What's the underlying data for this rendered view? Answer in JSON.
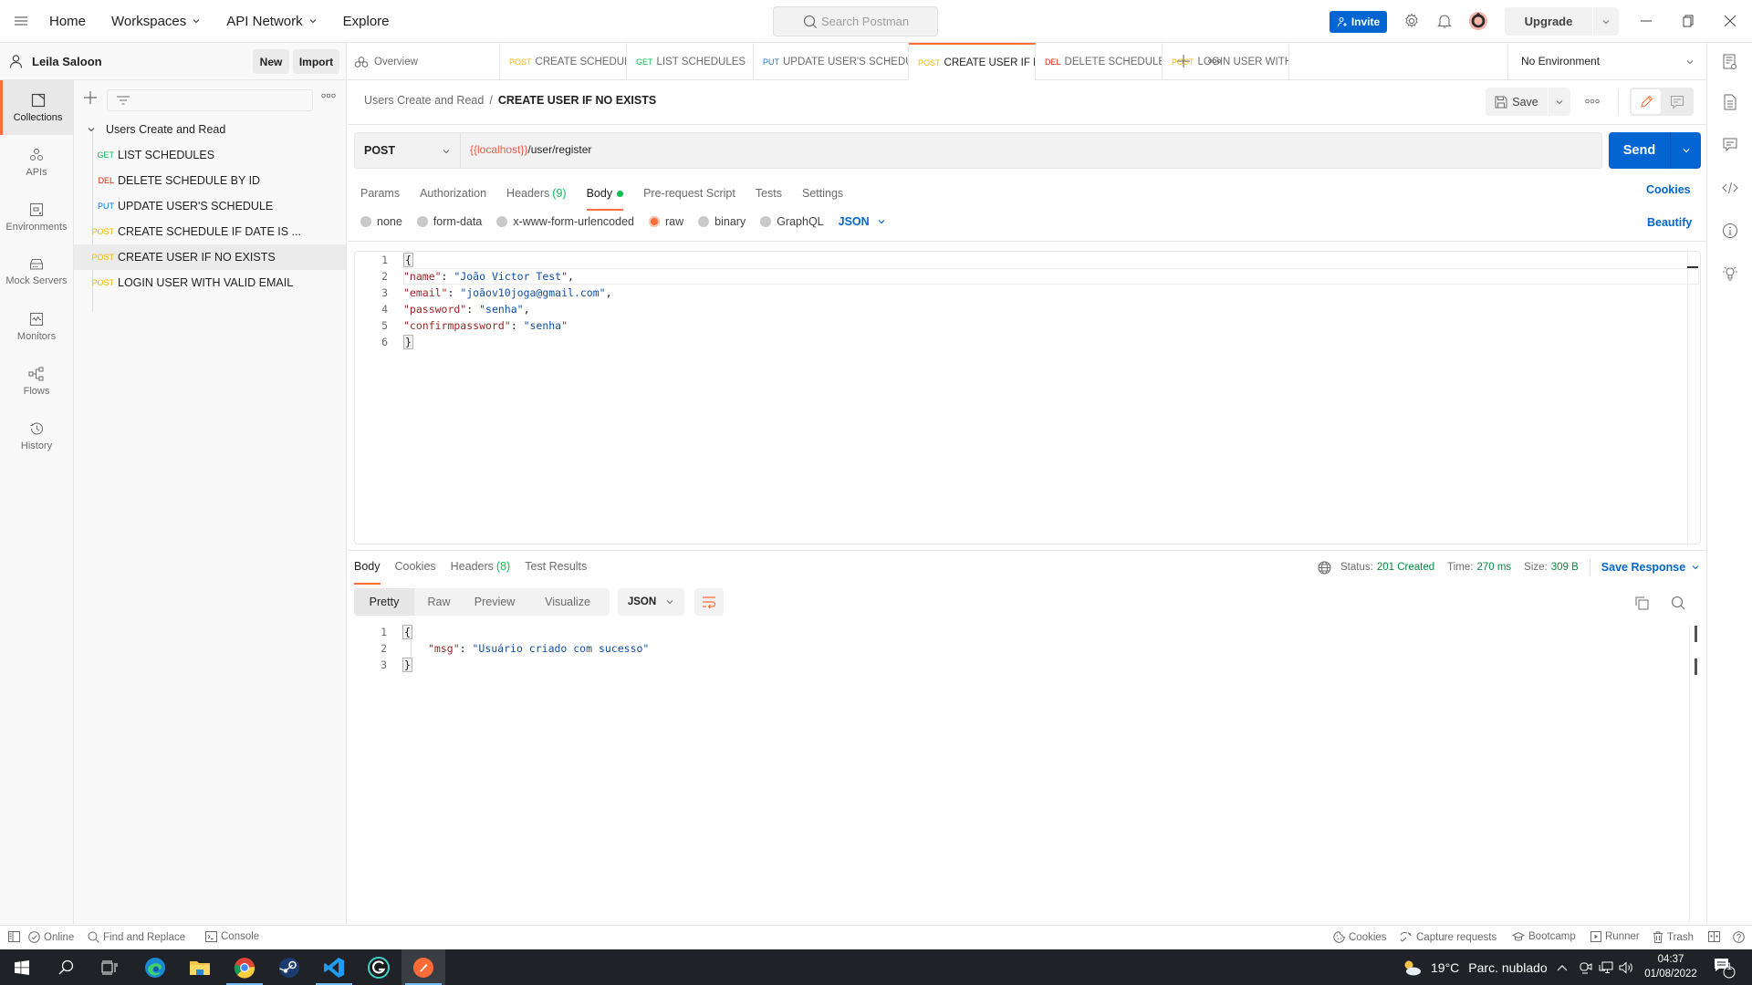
{
  "header": {
    "nav": [
      {
        "label": "Home",
        "has_dropdown": false
      },
      {
        "label": "Workspaces",
        "has_dropdown": true
      },
      {
        "label": "API Network",
        "has_dropdown": true
      },
      {
        "label": "Explore",
        "has_dropdown": false
      }
    ],
    "search_placeholder": "Search Postman",
    "invite_label": "Invite",
    "upgrade_label": "Upgrade"
  },
  "workspace": {
    "name": "Leila Saloon",
    "new_label": "New",
    "import_label": "Import"
  },
  "rail": [
    {
      "label": "Collections",
      "icon": "collections-icon",
      "active": true
    },
    {
      "label": "APIs",
      "icon": "apis-icon",
      "active": false
    },
    {
      "label": "Environments",
      "icon": "environments-icon",
      "active": false
    },
    {
      "label": "Mock Servers",
      "icon": "mock-servers-icon",
      "active": false
    },
    {
      "label": "Monitors",
      "icon": "monitors-icon",
      "active": false
    },
    {
      "label": "Flows",
      "icon": "flows-icon",
      "active": false
    },
    {
      "label": "History",
      "icon": "history-icon",
      "active": false
    }
  ],
  "collection": {
    "name": "Users Create and Read",
    "requests": [
      {
        "method": "GET",
        "name": "LIST SCHEDULES",
        "active": false
      },
      {
        "method": "DEL",
        "name": "DELETE SCHEDULE BY ID",
        "active": false
      },
      {
        "method": "PUT",
        "name": "UPDATE USER'S SCHEDULE",
        "active": false
      },
      {
        "method": "POST",
        "name": "CREATE SCHEDULE IF DATE IS ...",
        "active": false
      },
      {
        "method": "POST",
        "name": "CREATE USER IF NO EXISTS",
        "active": true
      },
      {
        "method": "POST",
        "name": "LOGIN USER WITH VALID EMAIL",
        "active": false
      }
    ]
  },
  "tabs": {
    "overview_label": "Overview",
    "items": [
      {
        "method": "POST",
        "name": "CREATE SCHEDULE IF D",
        "active": false
      },
      {
        "method": "GET",
        "name": "LIST SCHEDULES",
        "active": false
      },
      {
        "method": "PUT",
        "name": "UPDATE USER'S SCHEDU",
        "active": false
      },
      {
        "method": "POST",
        "name": "CREATE USER IF NO",
        "active": true,
        "unsaved": true
      },
      {
        "method": "DEL",
        "name": "DELETE SCHEDULE BY I",
        "active": false
      },
      {
        "method": "POST",
        "name": "LOGIN USER WITH VALI",
        "active": false
      }
    ],
    "environment": "No Environment"
  },
  "request": {
    "breadcrumb_parent": "Users Create and Read",
    "breadcrumb_separator": "/",
    "breadcrumb_current": "CREATE USER IF NO EXISTS",
    "save_label": "Save",
    "method": "POST",
    "url_variable": "{{localhost}}",
    "url_path": "/user/register",
    "send_label": "Send",
    "tabs": [
      {
        "label": "Params",
        "count": null,
        "active": false
      },
      {
        "label": "Authorization",
        "count": null,
        "active": false
      },
      {
        "label": "Headers",
        "count": "(9)",
        "active": false
      },
      {
        "label": "Body",
        "count": null,
        "active": true,
        "dot": true
      },
      {
        "label": "Pre-request Script",
        "count": null,
        "active": false
      },
      {
        "label": "Tests",
        "count": null,
        "active": false
      },
      {
        "label": "Settings",
        "count": null,
        "active": false
      }
    ],
    "cookies_label": "Cookies",
    "beautify_label": "Beautify",
    "body_types": [
      {
        "label": "none",
        "selected": false
      },
      {
        "label": "form-data",
        "selected": false
      },
      {
        "label": "x-www-form-urlencoded",
        "selected": false
      },
      {
        "label": "raw",
        "selected": true
      },
      {
        "label": "binary",
        "selected": false
      },
      {
        "label": "GraphQL",
        "selected": false
      }
    ],
    "body_language": "JSON",
    "body_lines": [
      {
        "n": "1",
        "text": "{"
      },
      {
        "n": "2",
        "key": "\"name\"",
        "value": "\"João Victor Test\"",
        "trail": ","
      },
      {
        "n": "3",
        "key": "\"email\"",
        "value": "\"joãov10joga@gmail.com\"",
        "trail": ","
      },
      {
        "n": "4",
        "key": "\"password\"",
        "value": "\"senha\"",
        "trail": ","
      },
      {
        "n": "5",
        "key": "\"confirmpassword\"",
        "value": "\"senha\"",
        "trail": ""
      },
      {
        "n": "6",
        "text": "}"
      }
    ]
  },
  "response": {
    "tabs": [
      {
        "label": "Body",
        "count": null,
        "active": true
      },
      {
        "label": "Cookies",
        "count": null,
        "active": false
      },
      {
        "label": "Headers",
        "count": "(8)",
        "active": false
      },
      {
        "label": "Test Results",
        "count": null,
        "active": false
      }
    ],
    "status_label": "Status:",
    "status_value": "201 Created",
    "time_label": "Time:",
    "time_value": "270 ms",
    "size_label": "Size:",
    "size_value": "309 B",
    "save_response_label": "Save Response",
    "views": [
      "Pretty",
      "Raw",
      "Preview",
      "Visualize"
    ],
    "active_view": "Pretty",
    "language": "JSON",
    "body_lines": [
      {
        "n": "1",
        "text": "{"
      },
      {
        "n": "2",
        "key": "\"msg\"",
        "value": "\"Usuário criado com sucesso\""
      },
      {
        "n": "3",
        "text": "}"
      }
    ]
  },
  "statusbar": {
    "online": "Online",
    "find_replace": "Find and Replace",
    "console": "Console",
    "cookies": "Cookies",
    "capture": "Capture requests",
    "bootcamp": "Bootcamp",
    "runner": "Runner",
    "trash": "Trash"
  },
  "taskbar": {
    "apps": [
      "start",
      "search",
      "task-view",
      "edge",
      "file-explorer",
      "chrome",
      "steam",
      "vscode",
      "app-g",
      "postman"
    ],
    "weather_temp": "19°C",
    "weather_desc": "Parc. nublado",
    "time": "04:37",
    "date": "01/08/2022",
    "notification_count": "1"
  },
  "colors": {
    "accent": "#ff6c37",
    "primary_blue": "#0265d2",
    "get": "#0cbb52",
    "delete": "#eb2013",
    "put": "#097bed",
    "post": "#ffb400",
    "success": "#0a8a3f"
  }
}
